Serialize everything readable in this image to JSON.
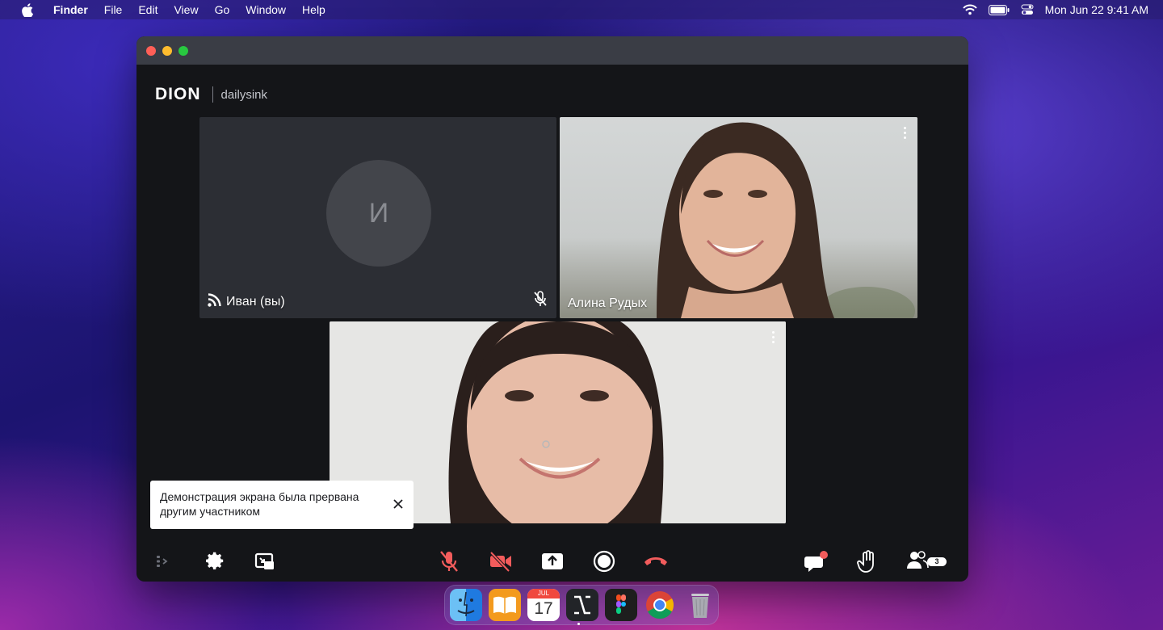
{
  "menubar": {
    "app_name": "Finder",
    "items": [
      "File",
      "Edit",
      "View",
      "Go",
      "Window",
      "Help"
    ],
    "clock": "Mon Jun 22  9:41 AM"
  },
  "app": {
    "logo": "DION",
    "room_name": "dailysink"
  },
  "tiles": [
    {
      "name": "Иван (вы)",
      "initial": "И",
      "mic_muted": true,
      "icon": "speaking-icon"
    },
    {
      "name": "Алина Рудых",
      "menu": "kebab-icon"
    },
    {
      "name": "",
      "menu": "kebab-icon"
    }
  ],
  "toast": {
    "text": "Демонстрация экрана была прервана другим участником"
  },
  "toolbar": {
    "left": [
      "side-panel-icon",
      "settings-icon",
      "picture-in-picture-icon"
    ],
    "center": [
      "mic-off-icon",
      "camera-off-icon",
      "share-screen-icon",
      "record-icon",
      "hang-up-icon"
    ],
    "right": [
      "chat-icon",
      "raise-hand-icon",
      "participants-icon"
    ],
    "participants_count": "3",
    "danger_color": "#f25c5c"
  },
  "calendar": {
    "month": "JUL",
    "day": "17"
  },
  "dock": [
    "finder-icon",
    "books-icon",
    "calendar-icon",
    "app-icon",
    "figma-icon",
    "chrome-icon",
    "trash-icon"
  ]
}
